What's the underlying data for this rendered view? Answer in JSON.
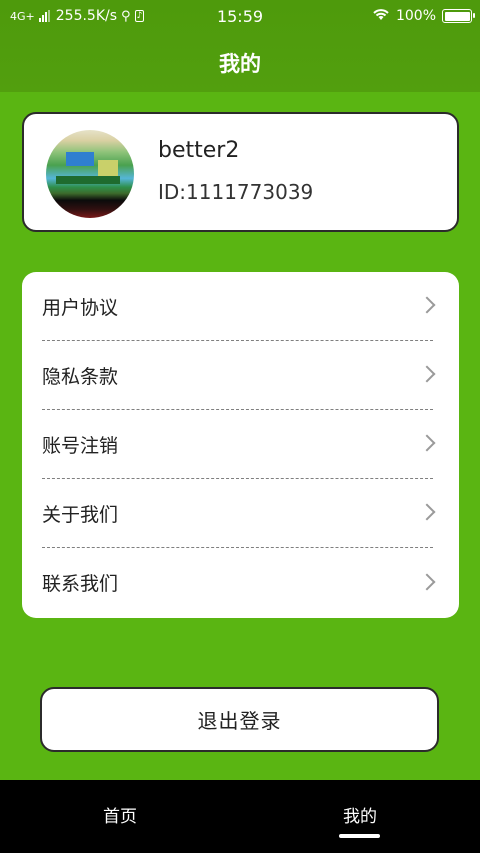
{
  "status_bar": {
    "network": "4G+",
    "speed": "255.5K/s",
    "time": "15:59",
    "battery": "100%",
    "battery_level": 1.0
  },
  "header": {
    "title": "我的"
  },
  "profile": {
    "username": "better2",
    "user_id": "ID:1111773039"
  },
  "menu": {
    "items": [
      {
        "label": "用户协议"
      },
      {
        "label": "隐私条款"
      },
      {
        "label": "账号注销"
      },
      {
        "label": "关于我们"
      },
      {
        "label": "联系我们"
      }
    ]
  },
  "logout": {
    "label": "退出登录"
  },
  "tabbar": {
    "tabs": [
      {
        "label": "首页"
      },
      {
        "label": "我的"
      }
    ],
    "active": "我的"
  },
  "colors": {
    "background": "#5ab512",
    "header": "#4e9a0c",
    "tabbar": "#000000"
  }
}
